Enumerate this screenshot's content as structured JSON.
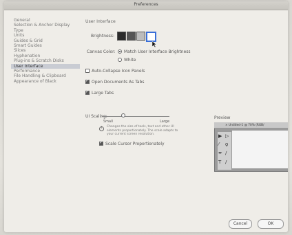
{
  "window": {
    "title": "Preferences"
  },
  "sidebar": {
    "items": [
      {
        "label": "General"
      },
      {
        "label": "Selection & Anchor Display"
      },
      {
        "label": "Type"
      },
      {
        "label": "Units"
      },
      {
        "label": "Guides & Grid"
      },
      {
        "label": "Smart Guides"
      },
      {
        "label": "Slices"
      },
      {
        "label": "Hyphenation"
      },
      {
        "label": "Plug-ins & Scratch Disks"
      },
      {
        "label": "User Interface"
      },
      {
        "label": "Performance"
      },
      {
        "label": "File Handling & Clipboard"
      },
      {
        "label": "Appearance of Black"
      }
    ],
    "selected_index": 9
  },
  "main": {
    "section_title": "User Interface",
    "brightness_label": "Brightness:",
    "brightness_swatches": [
      "#2b2b2b",
      "#555555",
      "#bcbcbc",
      "#ffffff"
    ],
    "canvas_color_label": "Canvas Color:",
    "canvas_options": [
      "Match User Interface Brightness",
      "White"
    ],
    "auto_collapse": "Auto-Collapse Icon Panels",
    "open_docs_tabs": "Open Documents As Tabs",
    "large_tabs": "Large Tabs",
    "ui_scaling_label": "UI Scaling:",
    "ui_scaling_small": "Small",
    "ui_scaling_large": "Large",
    "info_text": "Changes the size of tools, text and other UI elements proportionately. The scale adapts to your current screen resolution.",
    "scale_cursor": "Scale Cursor Proportionately",
    "preview_label": "Preview",
    "preview_tab": "× Untitled-1 @ 70% (RGB/"
  },
  "buttons": {
    "cancel": "Cancel",
    "ok": "OK"
  }
}
